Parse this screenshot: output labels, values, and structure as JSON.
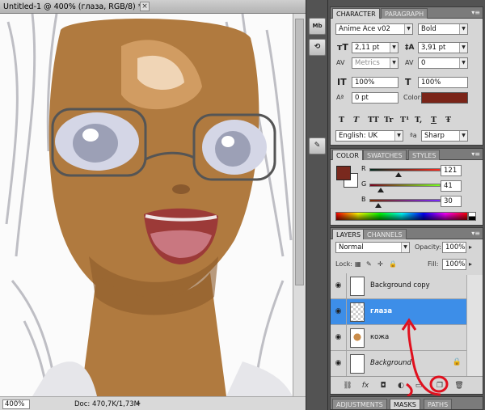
{
  "document": {
    "title": "Untitled-1 @ 400% (глаза, RGB/8) *",
    "close_glyph": "×",
    "zoom": "400%",
    "doc_info": "Doc: 470,7K/1,73M"
  },
  "icon_strip": [
    "Mb",
    "⚙"
  ],
  "character": {
    "tabs": [
      "CHARACTER",
      "PARAGRAPH"
    ],
    "font_family": "Anime Ace v02",
    "font_style": "Bold",
    "font_size": "2,11 pt",
    "leading": "3,91 pt",
    "kerning": "Metrics",
    "tracking": "0",
    "vertical_scale": "100%",
    "horizontal_scale": "100%",
    "baseline_shift": "0 pt",
    "color_label": "Color:",
    "text_color": "#7a2418",
    "style_buttons": [
      "T",
      "T",
      "TT",
      "Tr",
      "T¹",
      "T,",
      "T",
      "Ŧ"
    ],
    "language": "English: UK",
    "aa_icon": "ªa",
    "antialias": "Sharp"
  },
  "color": {
    "tabs": [
      "COLOR",
      "SWATCHES",
      "STYLES"
    ],
    "labels": [
      "R",
      "G",
      "B"
    ],
    "values": {
      "R": "121",
      "G": "41",
      "B": "30"
    },
    "foreground": "#79291e",
    "background": "#ffffff"
  },
  "layers": {
    "tabs": [
      "LAYERS",
      "CHANNELS"
    ],
    "blend_mode": "Normal",
    "opacity_label": "Opacity:",
    "opacity": "100%",
    "lock_label": "Lock:",
    "fill_label": "Fill:",
    "fill": "100%",
    "items": [
      {
        "name": "Background copy",
        "selected": false
      },
      {
        "name": "глаза",
        "selected": true
      },
      {
        "name": "кожа",
        "selected": false
      },
      {
        "name": "Background",
        "selected": false,
        "locked": true
      }
    ]
  },
  "bottom_tabs": [
    "ADJUSTMENTS",
    "MASKS",
    "PATHS"
  ],
  "colors": {
    "panel_bg": "#d6d6d6",
    "selection": "#3d8ee8",
    "annotation": "#e0101e"
  }
}
